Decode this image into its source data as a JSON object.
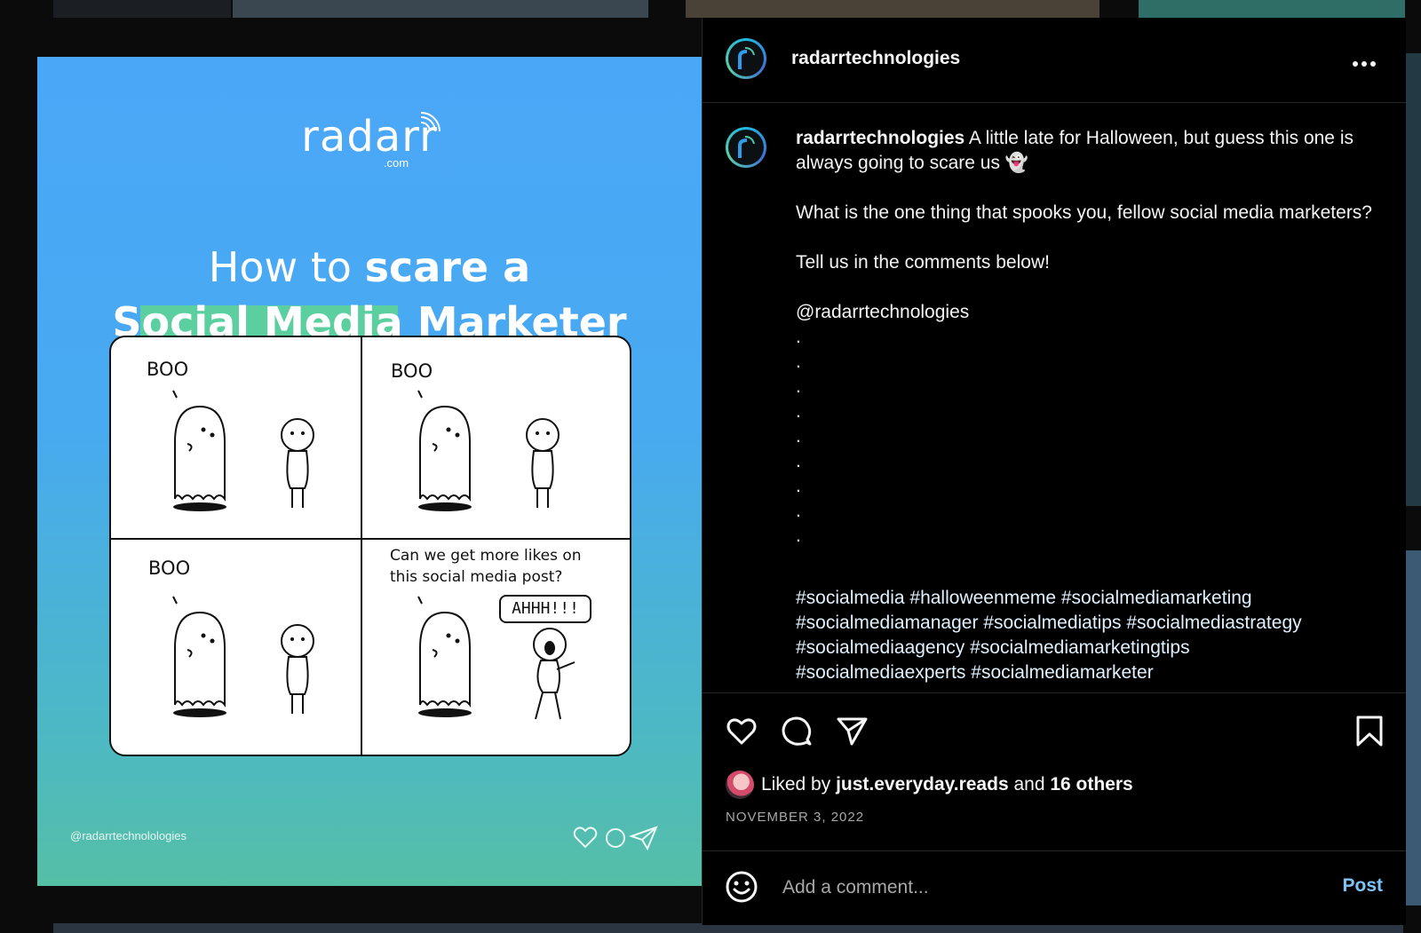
{
  "post": {
    "username": "radarrtechnologies",
    "more_icon": "more-horizontal-icon",
    "image": {
      "brand_name": "radarr",
      "brand_domain": ".com",
      "headline_part1": "How to ",
      "headline_bold": "scare a",
      "headline_line2": "Social Media Marketer",
      "panels": [
        {
          "text": "BOO"
        },
        {
          "text": "BOO"
        },
        {
          "text": "BOO"
        },
        {
          "text": "Can we get more likes on this social media post?",
          "reply": "AHHH!!!"
        }
      ],
      "handle": "@radarrtechnolologies"
    },
    "caption": {
      "username": "radarrtechnologies",
      "line1": " A little late for Halloween, but guess this one is always going to scare us 👻",
      "line2": "What is the one thing that spooks you, fellow social media marketers?",
      "line3": "Tell us in the comments below!",
      "mention": "@radarrtechnologies",
      "dots": [
        ".",
        ".",
        ".",
        ".",
        ".",
        ".",
        ".",
        ".",
        "."
      ],
      "hashtags": [
        "#socialmedia #halloweenmeme #socialmediamarketing",
        "#socialmediamanager #socialmediatips #socialmediastrategy",
        "#socialmediaagency #socialmediamarketingtips",
        "#socialmediaexperts #socialmediamarketer"
      ]
    },
    "actions": {
      "like_icon": "heart-icon",
      "comment_icon": "comment-bubble-icon",
      "share_icon": "paper-plane-icon",
      "save_icon": "bookmark-icon"
    },
    "likes": {
      "prefix": "Liked by ",
      "user": "just.everyday.reads",
      "middle": " and ",
      "others": "16 others"
    },
    "date": "NOVEMBER 3, 2022",
    "comment": {
      "placeholder": "Add a comment...",
      "post_label": "Post",
      "emoji_icon": "smiley-icon"
    }
  },
  "colors": {
    "panel_bg": "#000000",
    "post_button": "#7fc4f8",
    "image_top": "#4aa7f8",
    "image_bottom": "#55bfa6",
    "highlight": "#5ccfa0"
  }
}
